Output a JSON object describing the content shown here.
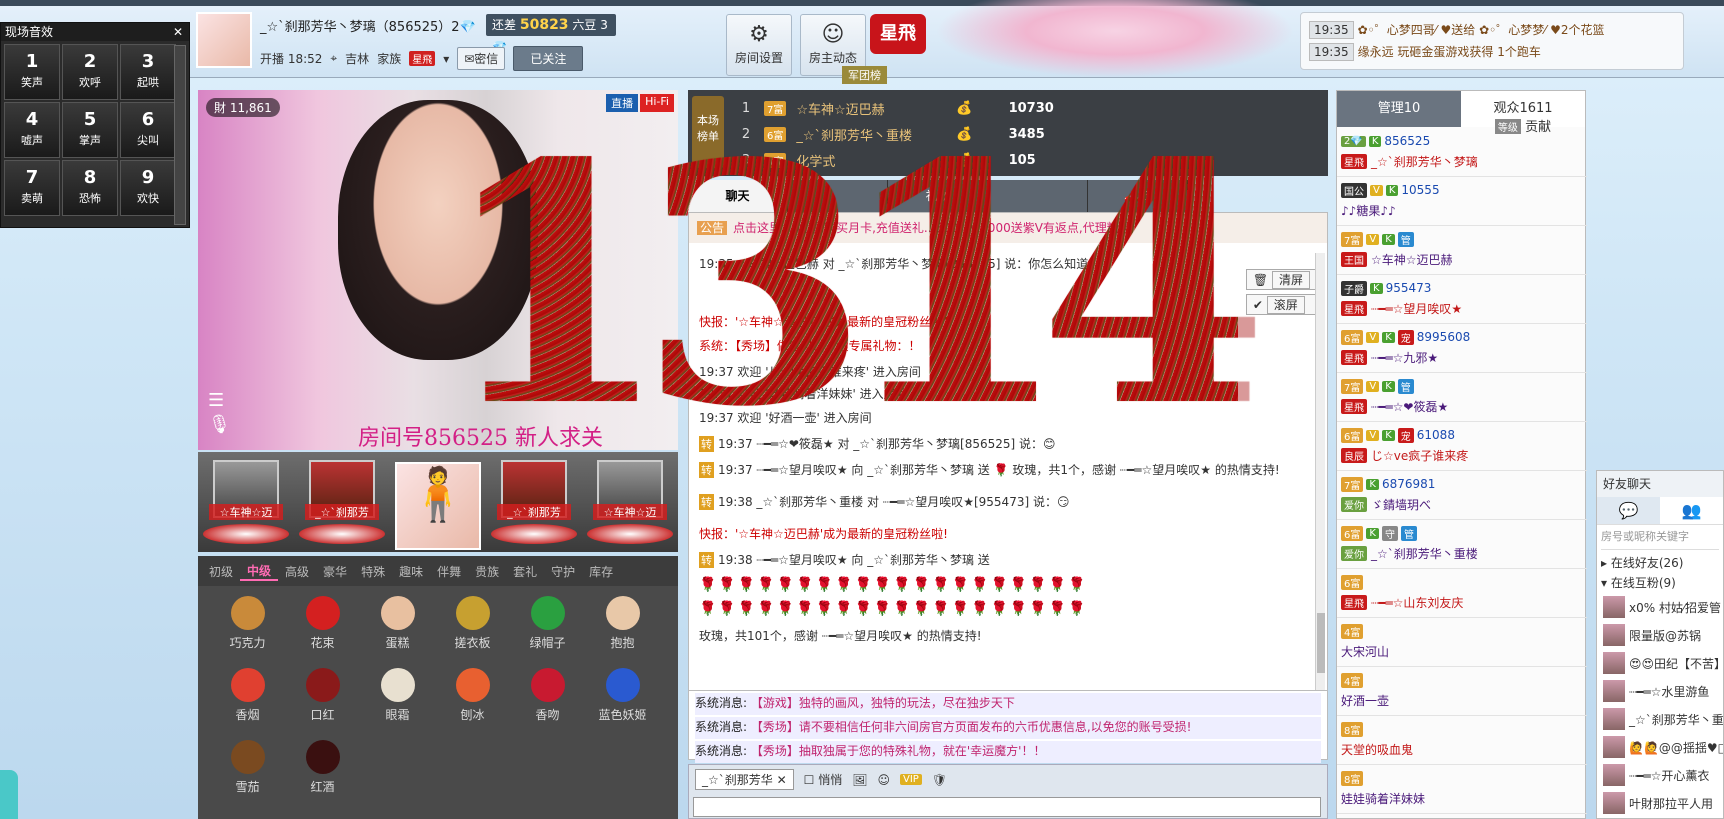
{
  "sound_panel": {
    "title": "现场音效",
    "keys": [
      {
        "num": "1",
        "label": "笑声"
      },
      {
        "num": "2",
        "label": "欢呼"
      },
      {
        "num": "3",
        "label": "起哄"
      },
      {
        "num": "4",
        "label": "嘘声"
      },
      {
        "num": "5",
        "label": "掌声"
      },
      {
        "num": "6",
        "label": "尖叫"
      },
      {
        "num": "7",
        "label": "卖萌"
      },
      {
        "num": "8",
        "label": "恐怖"
      },
      {
        "num": "9",
        "label": "欢快"
      }
    ]
  },
  "host": {
    "name": "_☆`刹那芳华丶梦璃（856525）2",
    "bean_label": "还差",
    "bean_value": "50823",
    "bean_unit": "六豆",
    "bean_level": "3",
    "start_time": "开播 18:52",
    "location": "吉林",
    "family_label": "家族",
    "family_tag": "星飛",
    "msg_button": "密信",
    "follow_button": "已关注"
  },
  "top_buttons": [
    {
      "icon": "gear-icon",
      "label": "房间设置",
      "glyph": "⚙"
    },
    {
      "icon": "person-icon",
      "label": "房主动态",
      "glyph": "☺"
    }
  ],
  "brand": {
    "logo": "星飛",
    "badge": "军团榜"
  },
  "notices": [
    {
      "time": "19:35",
      "text": "✿◦゜心梦四哥⁄ ♥送给 ✿◦゜心梦梦⁄ ♥2个花篮"
    },
    {
      "time": "19:35",
      "text": "缘永远 玩砸金蛋游戏获得 1个跑车"
    }
  ],
  "video": {
    "wealth": "11,861",
    "live": "直播",
    "hifi": "Hi-Fi",
    "room_caption": "房间号856525  新人求关"
  },
  "seats": [
    {
      "name": "☆车神☆迈",
      "kind": "car"
    },
    {
      "name": "_☆`刹那芳",
      "kind": "red"
    },
    {
      "name": "",
      "kind": "avatar"
    },
    {
      "name": "_☆`刹那芳",
      "kind": "red"
    },
    {
      "name": "☆车神☆迈",
      "kind": "car"
    }
  ],
  "gift_tabs": [
    "初级",
    "中级",
    "高级",
    "豪华",
    "特殊",
    "趣味",
    "伴舞",
    "贵族",
    "套礼",
    "守护",
    "库存"
  ],
  "gift_tab_active": "中级",
  "gifts": [
    {
      "name": "巧克力",
      "color": "#c98a3a"
    },
    {
      "name": "花束",
      "color": "#d42020"
    },
    {
      "name": "蛋糕",
      "color": "#e8c0a0"
    },
    {
      "name": "搓衣板",
      "color": "#c7a030"
    },
    {
      "name": "绿帽子",
      "color": "#2aa040"
    },
    {
      "name": "抱抱",
      "color": "#e8c8a8"
    },
    {
      "name": "香烟",
      "color": "#e04030"
    },
    {
      "name": "口红",
      "color": "#8a1a1a"
    },
    {
      "name": "眼霜",
      "color": "#e8e0d0"
    },
    {
      "name": "刨冰",
      "color": "#e86030"
    },
    {
      "name": "香吻",
      "color": "#c81a30"
    },
    {
      "name": "蓝色妖姬",
      "color": "#2a5ad0"
    },
    {
      "name": "雪茄",
      "color": "#7a4a20"
    },
    {
      "name": "红酒",
      "color": "#3a1010"
    }
  ],
  "rank": {
    "label": "本场榜单",
    "rows": [
      {
        "no": "1",
        "lv": "7富",
        "name": "☆车神☆迈巴赫",
        "value": "10730"
      },
      {
        "no": "2",
        "lv": "6富",
        "name": "_☆`刹那芳华丶重楼",
        "value": "3485"
      },
      {
        "no": "3",
        "lv": "4富",
        "name": "化学式",
        "value": "105"
      }
    ]
  },
  "chat_tabs": [
    "聊天",
    "",
    "礼物",
    "",
    "5"
  ],
  "chat": {
    "announcement": "点击这里 ...优惠,购买月卡,充值送礼...500...V.2000送紫V有返点,代理糖果",
    "ann_icon": "公告",
    "clear_btn": "清屏",
    "scroll_btn": "滚屏",
    "lines": [
      {
        "t": "19:35 ☆车神☆迈巴赫 对 _☆`刹那芳华丶梦璃[856525] 说：你怎么知道"
      },
      {
        "t": "快报：'☆车神☆迈巴赫'成为最新的皇冠粉丝啦！"
      },
      {
        "t": "系统：【秀场】做宝贝...，领专属礼物：！"
      },
      {
        "t": "19:37 欢迎 'じ☆ve疯子谁来疼' 进入房间"
      },
      {
        "t": "19:37 欢迎 '娃娃骑着洋妹妹' 进入房间"
      },
      {
        "t": "19:37 欢迎 '好酒一壶' 进入房间"
      },
      {
        "t": "19:37 ┈━═☆❤筱磊★ 对 _☆`刹那芳华丶梦璃[856525] 说：😊"
      },
      {
        "t": "19:37 ┈━═☆望月唉叹★ 向 _☆`刹那芳华丶梦璃 送 🌹 玫瑰，共1个，感谢 ┈━═☆望月唉叹★ 的热情支持!"
      },
      {
        "t": "19:38 _☆`刹那芳华丶重楼 对 ┈━═☆望月唉叹★[955473] 说：😏"
      },
      {
        "t": "快报：'☆车神☆迈巴赫'成为最新的皇冠粉丝啦!"
      },
      {
        "t": "19:38 ┈━═☆望月唉叹★ 向 _☆`刹那芳华丶梦璃 送"
      },
      {
        "t": "玫瑰，共101个，感谢 ┈━═☆望月唉叹★ 的热情支持!"
      }
    ],
    "zhuan": "转"
  },
  "sys_messages": [
    {
      "prefix": "系统消息:",
      "text": "【游戏】独特的画风，独特的玩法，尽在独步天下"
    },
    {
      "prefix": "系统消息:",
      "text": "【秀场】请不要相信任何非六间房官方页面发布的六币优惠信息,以免您的账号受损!"
    },
    {
      "prefix": "系统消息:",
      "text": "【秀场】抽取独属于您的特殊礼物，就在'幸运魔方'！！"
    }
  ],
  "input": {
    "target": "_☆`刹那芳华",
    "private": "悄悄",
    "vip": "VIP"
  },
  "overlay_text": "1314",
  "right_panel": {
    "tab_admin": "管理10",
    "tab_audience": "观众1611",
    "sub_level": "等级",
    "sub_contrib": "贡献",
    "audience": [
      {
        "badges": [
          "2💎",
          "K"
        ],
        "id": "856525",
        "tag": "星飛",
        "name": "_☆`刹那芳华丶梦璃"
      },
      {
        "badges": [
          "国公",
          "V",
          "K"
        ],
        "id": "10555",
        "tag": "",
        "name": "♪♪糖果♪♪"
      },
      {
        "badges": [
          "7富",
          "V",
          "K",
          "管"
        ],
        "id": "",
        "tag": "王国",
        "name": "☆车神☆迈巴赫"
      },
      {
        "badges": [
          "子爵",
          "K"
        ],
        "id": "955473",
        "tag": "星飛",
        "name": "┈━═☆望月唉叹★"
      },
      {
        "badges": [
          "6富",
          "V",
          "K",
          "宠"
        ],
        "id": "8995608",
        "tag": "星飛",
        "name": "┈━═☆九邪★"
      },
      {
        "badges": [
          "7富",
          "V",
          "K",
          "管"
        ],
        "id": "",
        "tag": "星飛",
        "name": "┈━═☆❤筱磊★"
      },
      {
        "badges": [
          "6富",
          "V",
          "K",
          "宠"
        ],
        "id": "61088",
        "tag": "良辰",
        "name": "じ☆ve疯子谁来疼"
      },
      {
        "badges": [
          "7富",
          "K"
        ],
        "id": "6876981",
        "tag": "爱你",
        "name": "ゞ錆墙玥べ"
      },
      {
        "badges": [
          "6富",
          "K",
          "守",
          "管"
        ],
        "id": "",
        "tag": "爱你",
        "name": "_☆`刹那芳华丶重楼"
      },
      {
        "badges": [
          "6富"
        ],
        "id": "",
        "tag": "星飛",
        "name": "┈━═☆山东刘友庆"
      },
      {
        "badges": [
          "4富"
        ],
        "id": "",
        "tag": "",
        "name": "大宋河山"
      },
      {
        "badges": [
          "4富"
        ],
        "id": "",
        "tag": "",
        "name": "好酒一壶"
      },
      {
        "badges": [
          "8富"
        ],
        "id": "",
        "tag": "",
        "name": "天堂的吸血鬼"
      },
      {
        "badges": [
          "8富"
        ],
        "id": "",
        "tag": "",
        "name": "娃娃骑着洋妹妹"
      }
    ]
  },
  "friends": {
    "title": "好友聊天",
    "search": "房号或昵称关键字",
    "group_online": "在线好友(26)",
    "group_fans": "在线互粉(9)",
    "list": [
      "x0% 村姑⁄招爱管",
      "限量版@苏锅",
      "😍😍田纪【不苦】",
      "┈━═☆水里游鱼",
      "_☆`刹那芳华丶重",
      "🙋🙋@@揺揺♥□",
      "┈━═☆开心薰衣",
      "叶財那拉平人用"
    ]
  }
}
